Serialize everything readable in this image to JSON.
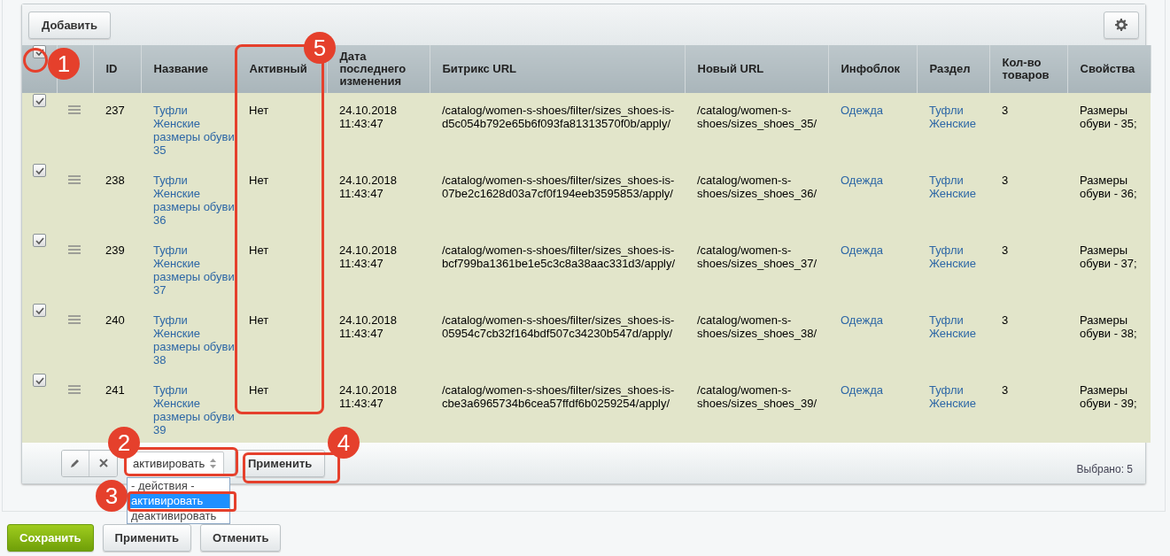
{
  "toolbar": {
    "add_button": "Добавить"
  },
  "table": {
    "select_all_checked": true,
    "columns": [
      "ID",
      "Название",
      "Активный",
      "Дата последнего изменения",
      "Битрикс URL",
      "Новый URL",
      "Инфоблок",
      "Раздел",
      "Кол-во товаров",
      "Свойства"
    ],
    "rows": [
      {
        "checked": true,
        "id": "237",
        "name": "Туфли Женские размеры обуви 35",
        "active": "Нет",
        "date": "24.10.2018 11:43:47",
        "bitrix_url": "/catalog/women-s-shoes/filter/sizes_shoes-is-d5c054b792e65b6f093fa81313570f0b/apply/",
        "new_url": "/catalog/women-s-shoes/sizes_shoes_35/",
        "infoblock": "Одежда",
        "section": "Туфли Женские",
        "count": "3",
        "properties": "Размеры обуви - 35;"
      },
      {
        "checked": true,
        "id": "238",
        "name": "Туфли Женские размеры обуви 36",
        "active": "Нет",
        "date": "24.10.2018 11:43:47",
        "bitrix_url": "/catalog/women-s-shoes/filter/sizes_shoes-is-07be2c1628d03a7cf0f194eeb3595853/apply/",
        "new_url": "/catalog/women-s-shoes/sizes_shoes_36/",
        "infoblock": "Одежда",
        "section": "Туфли Женские",
        "count": "3",
        "properties": "Размеры обуви - 36;"
      },
      {
        "checked": true,
        "id": "239",
        "name": "Туфли Женские размеры обуви 37",
        "active": "Нет",
        "date": "24.10.2018 11:43:47",
        "bitrix_url": "/catalog/women-s-shoes/filter/sizes_shoes-is-bcf799ba1361be1e5c3c8a38aac331d3/apply/",
        "new_url": "/catalog/women-s-shoes/sizes_shoes_37/",
        "infoblock": "Одежда",
        "section": "Туфли Женские",
        "count": "3",
        "properties": "Размеры обуви - 37;"
      },
      {
        "checked": true,
        "id": "240",
        "name": "Туфли Женские размеры обуви 38",
        "active": "Нет",
        "date": "24.10.2018 11:43:47",
        "bitrix_url": "/catalog/women-s-shoes/filter/sizes_shoes-is-05954c7cb32f164bdf507c34230b547d/apply/",
        "new_url": "/catalog/women-s-shoes/sizes_shoes_38/",
        "infoblock": "Одежда",
        "section": "Туфли Женские",
        "count": "3",
        "properties": "Размеры обуви - 38;"
      },
      {
        "checked": true,
        "id": "241",
        "name": "Туфли Женские размеры обуви 39",
        "active": "Нет",
        "date": "24.10.2018 11:43:47",
        "bitrix_url": "/catalog/women-s-shoes/filter/sizes_shoes-is-cbe3a6965734b6cea57ffdf6b0259254/apply/",
        "new_url": "/catalog/women-s-shoes/sizes_shoes_39/",
        "infoblock": "Одежда",
        "section": "Туфли Женские",
        "count": "3",
        "properties": "Размеры обуви - 39;"
      }
    ]
  },
  "footer": {
    "action_select": {
      "value": "активировать",
      "options": [
        {
          "label": "- действия -",
          "selected": false
        },
        {
          "label": "активировать",
          "selected": true
        },
        {
          "label": "деактивировать",
          "selected": false
        }
      ]
    },
    "apply_button": "Применить",
    "selected_count": "Выбрано: 5"
  },
  "form_buttons": [
    {
      "label": "Сохранить",
      "kind": "primary"
    },
    {
      "label": "Применить",
      "kind": "normal"
    },
    {
      "label": "Отменить",
      "kind": "normal"
    }
  ],
  "annotations": [
    "1",
    "2",
    "3",
    "4",
    "5"
  ]
}
